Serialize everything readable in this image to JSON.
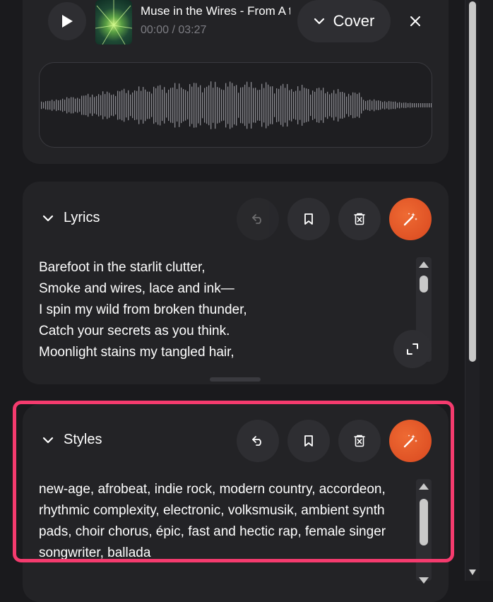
{
  "player": {
    "title": "Muse in the Wires - From A t",
    "time": "00:00 / 03:27",
    "cover_label": "Cover",
    "icons": {
      "play": "play-icon",
      "chevron": "chevron-down-icon",
      "close": "close-icon"
    }
  },
  "lyrics": {
    "heading": "Lyrics",
    "text": "Barefoot in the starlit clutter,\nSmoke and wires, lace and ink—\nI spin my wild from broken thunder,\nCatch your secrets as you think.\nMoonlight stains my tangled hair,",
    "icons": [
      "undo-icon",
      "bookmark-icon",
      "delete-icon",
      "magic-wand-icon",
      "expand-icon"
    ]
  },
  "styles": {
    "heading": "Styles",
    "text": "new-age, afrobeat, indie rock, modern country, accordeon,\nrhythmic complexity, electronic, volksmusik, ambient synth\npads, choir chorus, épic, fast and hectic rap, female singer\nsongwriter, ballada",
    "icons": [
      "undo-icon",
      "bookmark-icon",
      "delete-icon",
      "magic-wand-icon"
    ]
  },
  "colors": {
    "background": "#1a1a1d",
    "card": "#232326",
    "accent_orange": "#e0562a",
    "highlight_pink": "#f53b6e"
  }
}
